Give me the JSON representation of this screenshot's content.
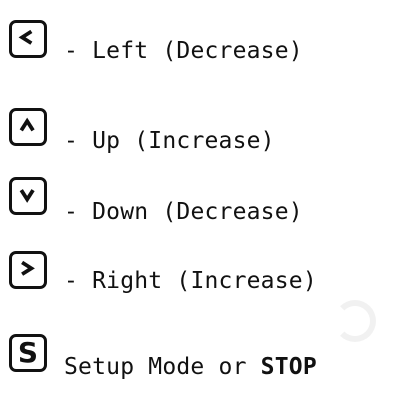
{
  "legend": {
    "left": {
      "key_icon": "chevron-left-icon",
      "prefix": "- ",
      "description": "Left (Decrease)"
    },
    "up": {
      "key_icon": "chevron-up-icon",
      "prefix": "- ",
      "description": "Up (Increase)"
    },
    "down": {
      "key_icon": "chevron-down-icon",
      "prefix": "- ",
      "description": "Down (Decrease)"
    },
    "right": {
      "key_icon": "chevron-right-icon",
      "prefix": "- ",
      "description": "Right (Increase)"
    },
    "setup": {
      "key_letter": "S",
      "description": "Setup Mode or ",
      "emphasis": "STOP"
    }
  },
  "colors": {
    "ink": "#111111",
    "background": "#ffffff"
  }
}
